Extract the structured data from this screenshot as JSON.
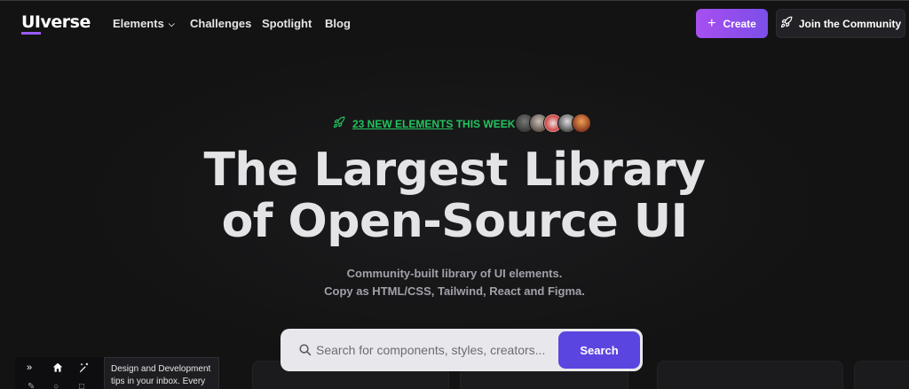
{
  "nav": {
    "logo_ui": "UI",
    "logo_rest": "verse",
    "links": [
      {
        "label": "Elements",
        "has_dropdown": true
      },
      {
        "label": "Challenges"
      },
      {
        "label": "Spotlight"
      },
      {
        "label": "Blog"
      }
    ],
    "create_label": "Create",
    "join_label": "Join the Community"
  },
  "hero": {
    "badge_count": "23 NEW ELEMENTS",
    "badge_suffix": " THIS WEEK!",
    "headline_line1": "The Largest Library",
    "headline_line2": "of Open-Source UI",
    "subtitle_line1": "Community-built library of UI elements.",
    "subtitle_line2": "Copy as HTML/CSS, Tailwind, React and Figma."
  },
  "search": {
    "placeholder": "Search for components, styles, creators...",
    "button_label": "Search"
  },
  "widget": {
    "tip_line1": "Design and Development",
    "tip_line2": "tips in your inbox. Every"
  },
  "colors": {
    "accent_purple": "#a84ff0",
    "badge_green": "#22c55e",
    "search_button": "#5b45e0",
    "background": "#131313"
  },
  "icons": [
    "rocket-icon",
    "plus-icon",
    "search-icon",
    "chevron-down-icon",
    "home-icon",
    "sparkle-icon"
  ]
}
